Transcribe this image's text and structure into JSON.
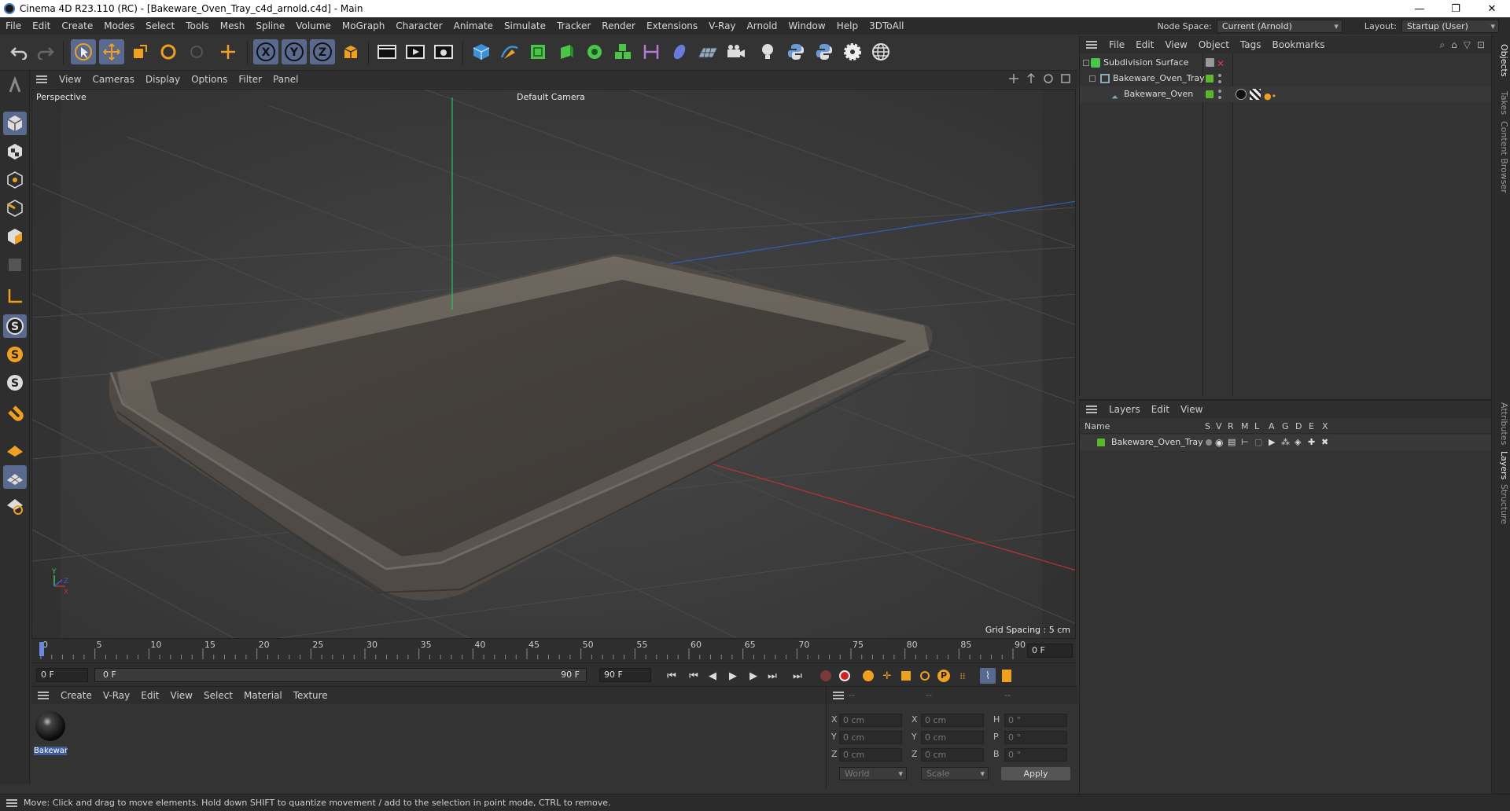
{
  "window": {
    "title": "Cinema 4D R23.110 (RC) - [Bakeware_Oven_Tray_c4d_arnold.c4d] - Main"
  },
  "menubar": {
    "items": [
      "File",
      "Edit",
      "Create",
      "Modes",
      "Select",
      "Tools",
      "Mesh",
      "Spline",
      "Volume",
      "MoGraph",
      "Character",
      "Animate",
      "Simulate",
      "Tracker",
      "Render",
      "Extensions",
      "V-Ray",
      "Arnold",
      "Window",
      "Help",
      "3DToAll"
    ],
    "node_space_label": "Node Space:",
    "node_space_value": "Current (Arnold)",
    "layout_label": "Layout:",
    "layout_value": "Startup (User)"
  },
  "viewport": {
    "menu": [
      "View",
      "Cameras",
      "Display",
      "Options",
      "Filter",
      "Panel"
    ],
    "view_name": "Perspective",
    "camera": "Default Camera",
    "grid_spacing": "Grid Spacing : 5 cm"
  },
  "timeline": {
    "ticks": [
      "0",
      "5",
      "10",
      "15",
      "20",
      "25",
      "30",
      "35",
      "40",
      "45",
      "50",
      "55",
      "60",
      "65",
      "70",
      "75",
      "80",
      "85",
      "90"
    ],
    "current_frame": "0 F",
    "start_frame": "0 F",
    "range_start": "0 F",
    "range_end": "90 F",
    "end_frame": "90 F"
  },
  "material_manager": {
    "menu": [
      "Create",
      "V-Ray",
      "Edit",
      "View",
      "Select",
      "Material",
      "Texture"
    ],
    "materials": [
      {
        "name": "Bakewar"
      }
    ]
  },
  "coordinates": {
    "headers": [
      "--",
      "--",
      "--"
    ],
    "rows": [
      {
        "l1": "X",
        "v1": "0 cm",
        "l2": "X",
        "v2": "0 cm",
        "l3": "H",
        "v3": "0 °"
      },
      {
        "l1": "Y",
        "v1": "0 cm",
        "l2": "Y",
        "v2": "0 cm",
        "l3": "P",
        "v3": "0 °"
      },
      {
        "l1": "Z",
        "v1": "0 cm",
        "l2": "Z",
        "v2": "0 cm",
        "l3": "B",
        "v3": "0 °"
      }
    ],
    "space": "World",
    "mode": "Scale",
    "apply": "Apply"
  },
  "objects_panel": {
    "menu": [
      "File",
      "Edit",
      "View",
      "Object",
      "Tags",
      "Bookmarks"
    ],
    "items": [
      {
        "name": "Subdivision Surface"
      },
      {
        "name": "Bakeware_Oven_Tray"
      },
      {
        "name": "Bakeware_Oven"
      }
    ]
  },
  "layers_panel": {
    "menu": [
      "Layers",
      "Edit",
      "View"
    ],
    "name_header": "Name",
    "columns": [
      "S",
      "V",
      "R",
      "M",
      "L",
      "A",
      "G",
      "D",
      "E",
      "X"
    ],
    "layers": [
      {
        "name": "Bakeware_Oven_Tray"
      }
    ]
  },
  "side_tabs": [
    "Objects",
    "Takes",
    "Content Browser",
    "Attributes",
    "Layers",
    "Structure"
  ],
  "status": {
    "text": "Move: Click and drag to move elements. Hold down SHIFT to quantize movement / add to the selection in point mode, CTRL to remove."
  },
  "colors": {
    "accent": "#5a6a8e",
    "layer_green": "#5ab82a",
    "x_axis": "#c03030",
    "y_axis": "#30c060",
    "z_axis": "#3060c0"
  }
}
